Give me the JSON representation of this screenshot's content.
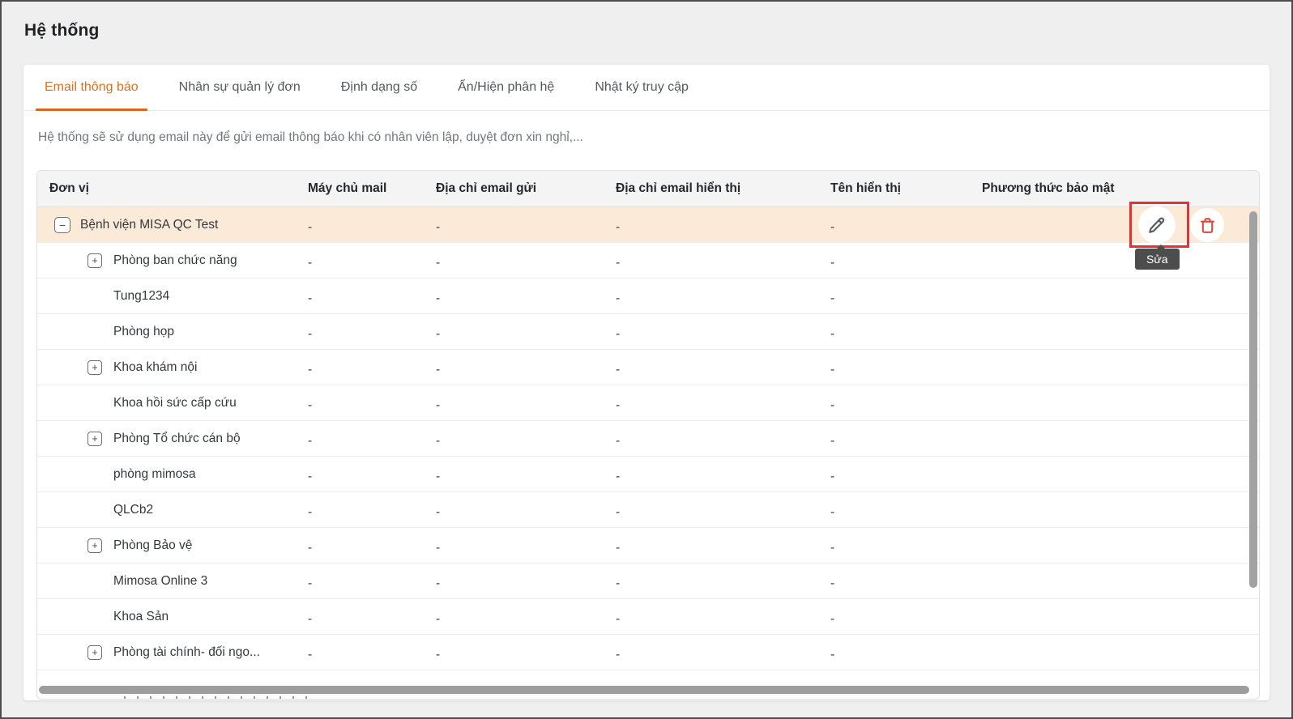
{
  "page": {
    "title": "Hệ thống",
    "description": "Hệ thống sẽ sử dụng email này để gửi email thông báo khi có nhân viên lập, duyệt đơn xin nghỉ,..."
  },
  "tabs": [
    {
      "key": "email-notification",
      "label": "Email thông báo",
      "active": true
    },
    {
      "key": "request-managers",
      "label": "Nhân sự quản lý đơn",
      "active": false
    },
    {
      "key": "number-format",
      "label": "Định dạng số",
      "active": false
    },
    {
      "key": "show-hide-modules",
      "label": "Ẩn/Hiện phân hệ",
      "active": false
    },
    {
      "key": "access-log",
      "label": "Nhật ký truy cập",
      "active": false
    }
  ],
  "table": {
    "columns": [
      "Đơn vị",
      "Máy chủ mail",
      "Địa chỉ email gửi",
      "Địa chỉ email hiển thị",
      "Tên hiển thị",
      "Phương thức bảo mật"
    ],
    "empty_value": "-",
    "rows": [
      {
        "name": "Bệnh viện MISA QC Test",
        "level": 1,
        "toggle": "minus",
        "highlighted": true,
        "show_actions": true
      },
      {
        "name": "Phòng ban chức năng",
        "level": 2,
        "toggle": "plus"
      },
      {
        "name": "Tung1234",
        "level": 2,
        "toggle": "none"
      },
      {
        "name": "Phòng họp",
        "level": 2,
        "toggle": "none"
      },
      {
        "name": "Khoa khám nội",
        "level": 2,
        "toggle": "plus"
      },
      {
        "name": "Khoa hồi sức cấp cứu",
        "level": 2,
        "toggle": "none"
      },
      {
        "name": "Phòng Tổ chức cán bộ",
        "level": 2,
        "toggle": "plus"
      },
      {
        "name": "phòng mimosa",
        "level": 2,
        "toggle": "none"
      },
      {
        "name": "QLCb2",
        "level": 2,
        "toggle": "none"
      },
      {
        "name": "Phòng Bảo vệ",
        "level": 2,
        "toggle": "plus"
      },
      {
        "name": "Mimosa Online 3",
        "level": 2,
        "toggle": "none"
      },
      {
        "name": "Khoa Sản",
        "level": 2,
        "toggle": "none"
      },
      {
        "name": "Phòng tài chính- đối ngo...",
        "level": 2,
        "toggle": "plus"
      }
    ]
  },
  "actions": {
    "edit_tooltip": "Sửa"
  },
  "colors": {
    "accent": "#e0701c",
    "underline": "#d9661b",
    "highlight": "#fcead8",
    "red-box": "#e23333",
    "delete-red": "#e0473d",
    "tooltip-bg": "#4d4d4d"
  }
}
